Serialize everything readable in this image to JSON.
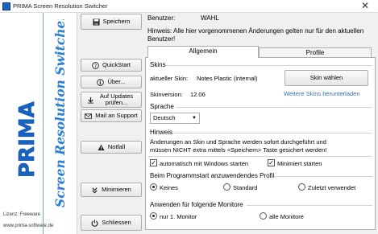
{
  "window": {
    "title": "PRIMA Screen Resolution Switcher",
    "close_glyph": "✕"
  },
  "brand": {
    "logo_text": "PRIMA",
    "vertical_text": "Screen Resolution Switcher",
    "license": "Lizenz: Freeware",
    "website": "www.prima-software.de",
    "accent": "#1565c0"
  },
  "buttons": {
    "save": "Speichern",
    "quickstart": "QuickStart",
    "about": "Über...",
    "updates": "Auf Updates prüfen...",
    "mail": "Mail an Support",
    "emergency": "Notfall",
    "minimize": "Minimieren",
    "close": "Schliessen"
  },
  "user": {
    "label": "Benutzer:",
    "value": "WAHL"
  },
  "hint_top": "Hinweis: Alle hier vorgenommenen Änderungen gelten nur für den aktuellen Benutzer!",
  "tabs": [
    "Allgemein",
    "Profile"
  ],
  "skins": {
    "title": "Skins",
    "current_label": "aktueller Skin:",
    "current_value": "Notes Plastic (internal)",
    "version_label": "Skinversion:",
    "version_value": "12.06",
    "choose_button": "Skin wählen",
    "download_link": "Weitere Skins herunterladen"
  },
  "language": {
    "title": "Sprache",
    "selected": "Deutsch"
  },
  "hint": {
    "title": "Hinweis",
    "line1": "Änderungen an Skin und Sprache werden sofort durchgeführt und",
    "line2": "müssen NICHT extra mittels <Speichern> Taste gesichert werden!"
  },
  "options": {
    "autostart": "automatisch mit Windows starten",
    "minimized": "Minimiert starten",
    "autostart_checked": true,
    "minimized_checked": true
  },
  "profile_on_start": {
    "title": "Beim Programmstart anzuwendendes Profil",
    "options": [
      "Keines",
      "Standard",
      "Zuletzt verwendet"
    ],
    "selected": "Keines"
  },
  "monitors": {
    "title": "Anwenden für folgende Monitore",
    "options": [
      "nur 1. Monitor",
      "alle Monitore"
    ],
    "selected": "nur 1. Monitor"
  }
}
